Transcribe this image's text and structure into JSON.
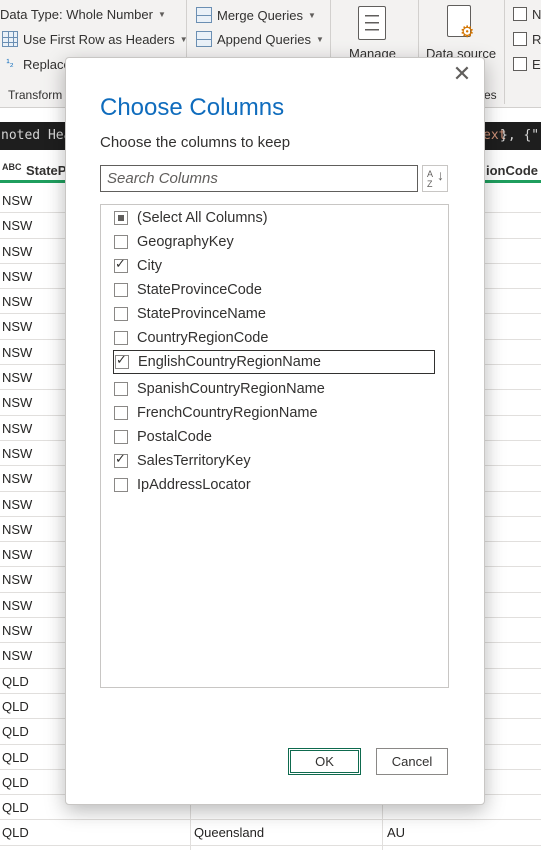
{
  "ribbon": {
    "data_type": "Data Type: Whole Number",
    "first_row_headers": "Use First Row as Headers",
    "replace": "Replace",
    "merge_queries": "Merge Queries",
    "append_queries": "Append Queries",
    "group_transform": "Transform",
    "manage": "Manage",
    "data_source": "Data source",
    "group_es": "es",
    "mini_n": "N",
    "mini_r": "R",
    "mini_e": "E"
  },
  "formula_bar": {
    "left_text": "noted Hea",
    "right_highlight": "ext",
    "right_rest": "}, {\""
  },
  "grid": {
    "abc_icon": "ABC",
    "header_col1": "StateP",
    "header_col3": "ionCode",
    "rows": [
      [
        "NSW",
        "",
        ""
      ],
      [
        "NSW",
        "",
        ""
      ],
      [
        "NSW",
        "",
        ""
      ],
      [
        "NSW",
        "",
        ""
      ],
      [
        "NSW",
        "",
        ""
      ],
      [
        "NSW",
        "",
        ""
      ],
      [
        "NSW",
        "",
        ""
      ],
      [
        "NSW",
        "",
        ""
      ],
      [
        "NSW",
        "",
        ""
      ],
      [
        "NSW",
        "",
        ""
      ],
      [
        "NSW",
        "",
        ""
      ],
      [
        "NSW",
        "",
        ""
      ],
      [
        "NSW",
        "",
        ""
      ],
      [
        "NSW",
        "",
        ""
      ],
      [
        "NSW",
        "",
        ""
      ],
      [
        "NSW",
        "",
        ""
      ],
      [
        "NSW",
        "",
        ""
      ],
      [
        "NSW",
        "",
        ""
      ],
      [
        "NSW",
        "",
        ""
      ],
      [
        "QLD",
        "",
        ""
      ],
      [
        "QLD",
        "",
        ""
      ],
      [
        "QLD",
        "",
        ""
      ],
      [
        "QLD",
        "",
        ""
      ],
      [
        "QLD",
        "",
        ""
      ],
      [
        "QLD",
        "",
        ""
      ],
      [
        "QLD",
        "Queensland",
        "AU"
      ],
      [
        "QLD",
        "Queensland",
        "AU"
      ]
    ]
  },
  "dialog": {
    "title": "Choose Columns",
    "subtitle": "Choose the columns to keep",
    "search_placeholder": "Search Columns",
    "sort_icon_text": "A Z",
    "columns": [
      {
        "label": "(Select All Columns)",
        "state": "partial"
      },
      {
        "label": "GeographyKey",
        "state": "unchecked"
      },
      {
        "label": "City",
        "state": "checked"
      },
      {
        "label": "StateProvinceCode",
        "state": "unchecked"
      },
      {
        "label": "StateProvinceName",
        "state": "unchecked"
      },
      {
        "label": "CountryRegionCode",
        "state": "unchecked"
      },
      {
        "label": "EnglishCountryRegionName",
        "state": "checked"
      },
      {
        "label": "SpanishCountryRegionName",
        "state": "unchecked"
      },
      {
        "label": "FrenchCountryRegionName",
        "state": "unchecked"
      },
      {
        "label": "PostalCode",
        "state": "unchecked"
      },
      {
        "label": "SalesTerritoryKey",
        "state": "checked"
      },
      {
        "label": "IpAddressLocator",
        "state": "unchecked"
      }
    ],
    "ok_label": "OK",
    "cancel_label": "Cancel",
    "close_glyph": "✕"
  },
  "colors": {
    "accent_title": "#0f6cbd",
    "header_underline": "#1f9e5e",
    "formula_bg": "#1e1e1e"
  }
}
